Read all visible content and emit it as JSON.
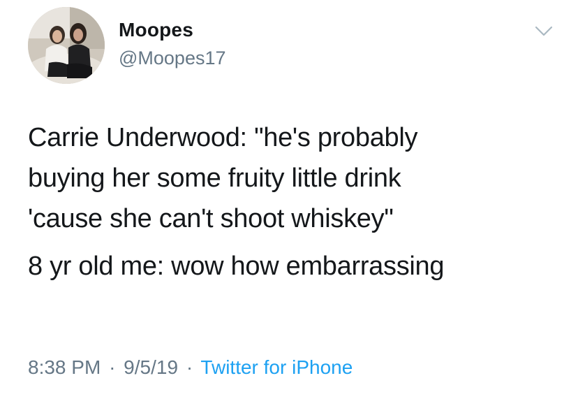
{
  "tweet": {
    "user": {
      "display_name": "Moopes",
      "handle": "@Moopes17"
    },
    "text_lines": [
      "Carrie Underwood: \"he's probably",
      "buying her some fruity little drink",
      "'cause she can't shoot whiskey\""
    ],
    "text_line_2": "8 yr old me: wow how embarrassing",
    "meta": {
      "time": "8:38 PM",
      "separator": "·",
      "date": "9/5/19",
      "source": "Twitter for iPhone"
    },
    "icons": {
      "menu": "chevron-down-icon",
      "avatar": "profile-photo"
    },
    "colors": {
      "text": "#14171a",
      "secondary": "#657786",
      "link": "#1da1f2"
    }
  }
}
